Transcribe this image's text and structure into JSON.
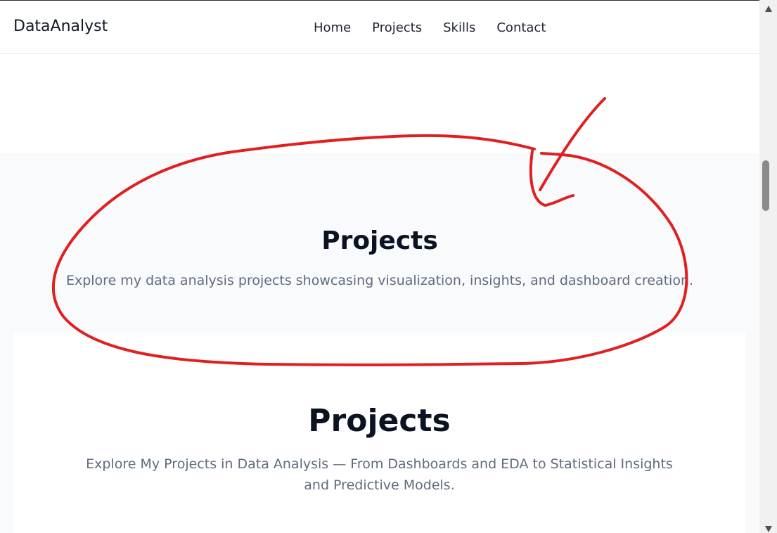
{
  "navbar": {
    "brand": "DataAnalyst",
    "links": [
      {
        "label": "Home"
      },
      {
        "label": "Projects"
      },
      {
        "label": "Skills"
      },
      {
        "label": "Contact"
      }
    ]
  },
  "projects_section": {
    "title": "Projects",
    "subtitle": "Explore my data analysis projects showcasing visualization, insights, and dashboard creation."
  },
  "projects_card": {
    "title": "Projects",
    "subtitle": "Explore My Projects in Data Analysis — From Dashboards and EDA to Statistical Insights and Predictive Models."
  },
  "annotation": {
    "color": "#e02020",
    "shapes": [
      "circle-highlight",
      "arrow"
    ]
  }
}
